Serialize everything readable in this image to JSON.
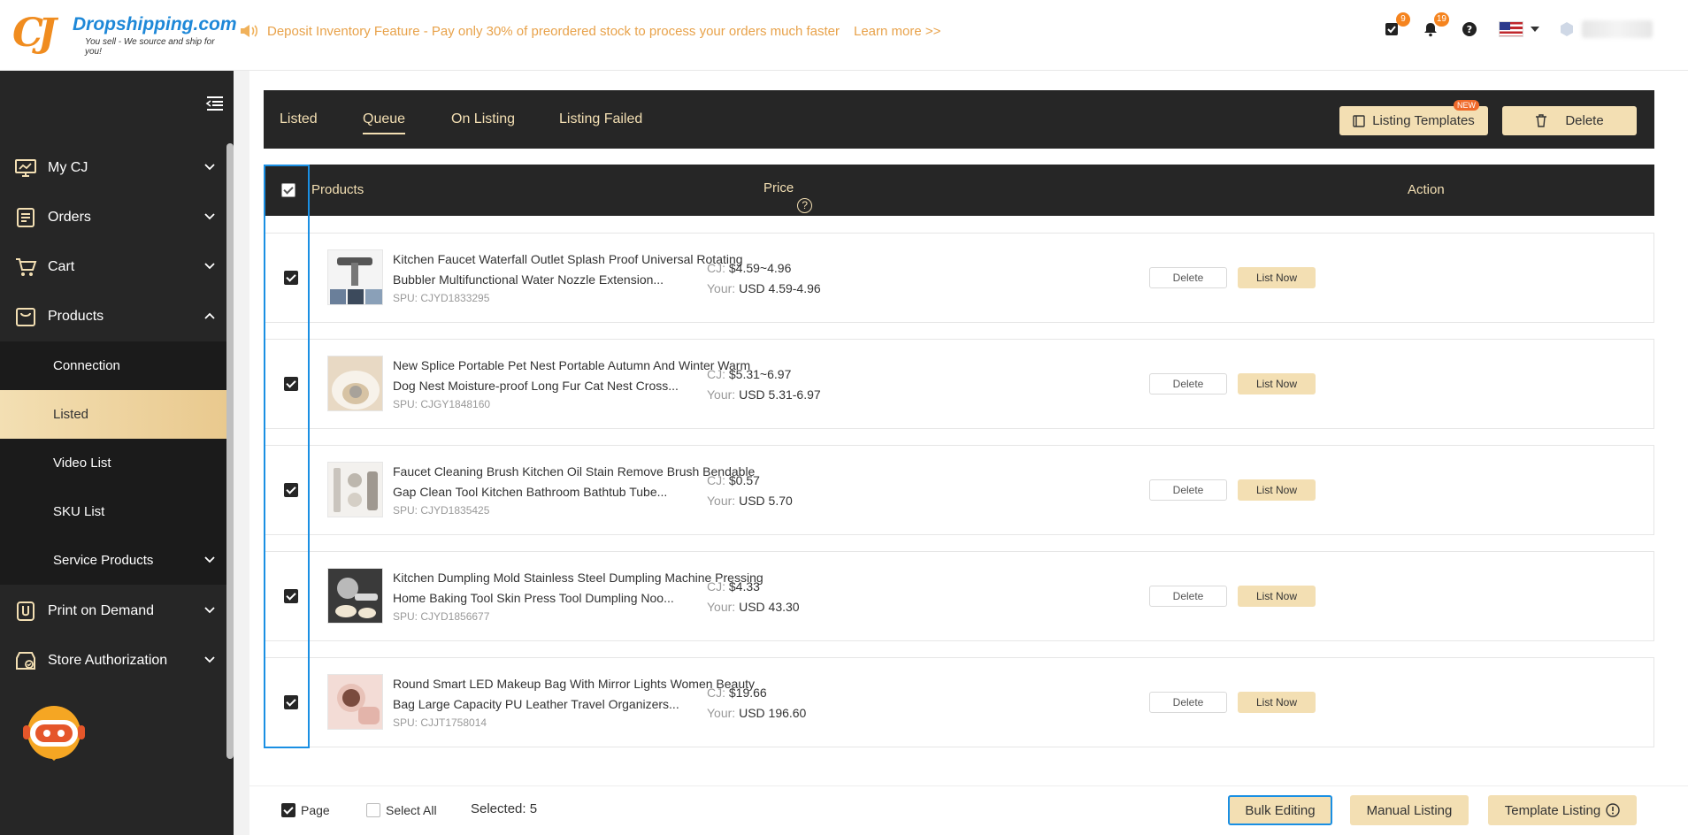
{
  "brand": {
    "name": "Dropshipping.com",
    "tagline": "You sell - We source and ship for you!",
    "logo_letters": "CJ"
  },
  "announcement": {
    "text": "Deposit Inventory Feature - Pay only 30% of preordered stock to process your orders much faster",
    "link": "Learn more >>"
  },
  "header": {
    "tasks_badge": "9",
    "notifications_badge": "19",
    "help_icon": "question-icon",
    "language_flag": "us-flag"
  },
  "sidebar": {
    "items": [
      {
        "label": "My CJ",
        "icon": "monitor-icon"
      },
      {
        "label": "Orders",
        "icon": "orders-icon"
      },
      {
        "label": "Cart",
        "icon": "cart-icon"
      },
      {
        "label": "Products",
        "icon": "bag-icon"
      },
      {
        "label": "Print on Demand",
        "icon": "pod-icon"
      },
      {
        "label": "Store Authorization",
        "icon": "store-icon"
      }
    ],
    "sub_items": [
      {
        "label": "Connection"
      },
      {
        "label": "Listed"
      },
      {
        "label": "Video List"
      },
      {
        "label": "SKU List"
      },
      {
        "label": "Service Products"
      }
    ]
  },
  "tabs": [
    {
      "label": "Listed"
    },
    {
      "label": "Queue"
    },
    {
      "label": "On Listing"
    },
    {
      "label": "Listing Failed"
    }
  ],
  "toolbar": {
    "templates_label": "Listing Templates",
    "new_badge": "NEW",
    "delete_label": "Delete"
  },
  "table": {
    "headers": {
      "products": "Products",
      "price": "Price",
      "action": "Action"
    },
    "rows": [
      {
        "title": "Kitchen Faucet Waterfall Outlet Splash Proof Universal Rotating Bubbler Multifunctional Water Nozzle Extension...",
        "spu": "SPU: CJYD1833295",
        "cj_label": "CJ:",
        "cj_price": "$4.59~4.96",
        "your_label": "Your:",
        "your_price": "USD 4.59-4.96",
        "delete": "Delete",
        "list_now": "List Now"
      },
      {
        "title": "New Splice Portable Pet Nest Portable Autumn And Winter Warm Dog Nest Moisture-proof Long Fur Cat Nest Cross...",
        "spu": "SPU: CJGY1848160",
        "cj_label": "CJ:",
        "cj_price": "$5.31~6.97",
        "your_label": "Your:",
        "your_price": "USD 5.31-6.97",
        "delete": "Delete",
        "list_now": "List Now"
      },
      {
        "title": "Faucet Cleaning Brush Kitchen Oil Stain Remove Brush Bendable Gap Clean Tool Kitchen Bathroom Bathtub Tube...",
        "spu": "SPU: CJYD1835425",
        "cj_label": "CJ:",
        "cj_price": "$0.57",
        "your_label": "Your:",
        "your_price": "USD 5.70",
        "delete": "Delete",
        "list_now": "List Now"
      },
      {
        "title": "Kitchen Dumpling Mold Stainless Steel Dumpling Machine Pressing Home Baking Tool Skin Press Tool Dumpling Noo...",
        "spu": "SPU: CJYD1856677",
        "cj_label": "CJ:",
        "cj_price": "$4.33",
        "your_label": "Your:",
        "your_price": "USD 43.30",
        "delete": "Delete",
        "list_now": "List Now"
      },
      {
        "title": "Round Smart LED Makeup Bag With Mirror Lights Women Beauty Bag Large Capacity PU Leather Travel Organizers...",
        "spu": "SPU: CJJT1758014",
        "cj_label": "CJ:",
        "cj_price": "$19.66",
        "your_label": "Your:",
        "your_price": "USD 196.60",
        "delete": "Delete",
        "list_now": "List Now"
      }
    ]
  },
  "footer": {
    "page_label": "Page",
    "select_all_label": "Select All",
    "selected_text": "Selected: 5",
    "bulk_editing": "Bulk Editing",
    "manual_listing": "Manual Listing",
    "template_listing": "Template Listing"
  },
  "colors": {
    "accent_gold": "#f3dfb3",
    "dark": "#262626",
    "focus_blue": "#1a8fe3",
    "announce_orange": "#e8a24a",
    "brand_blue": "#1e88d8"
  }
}
